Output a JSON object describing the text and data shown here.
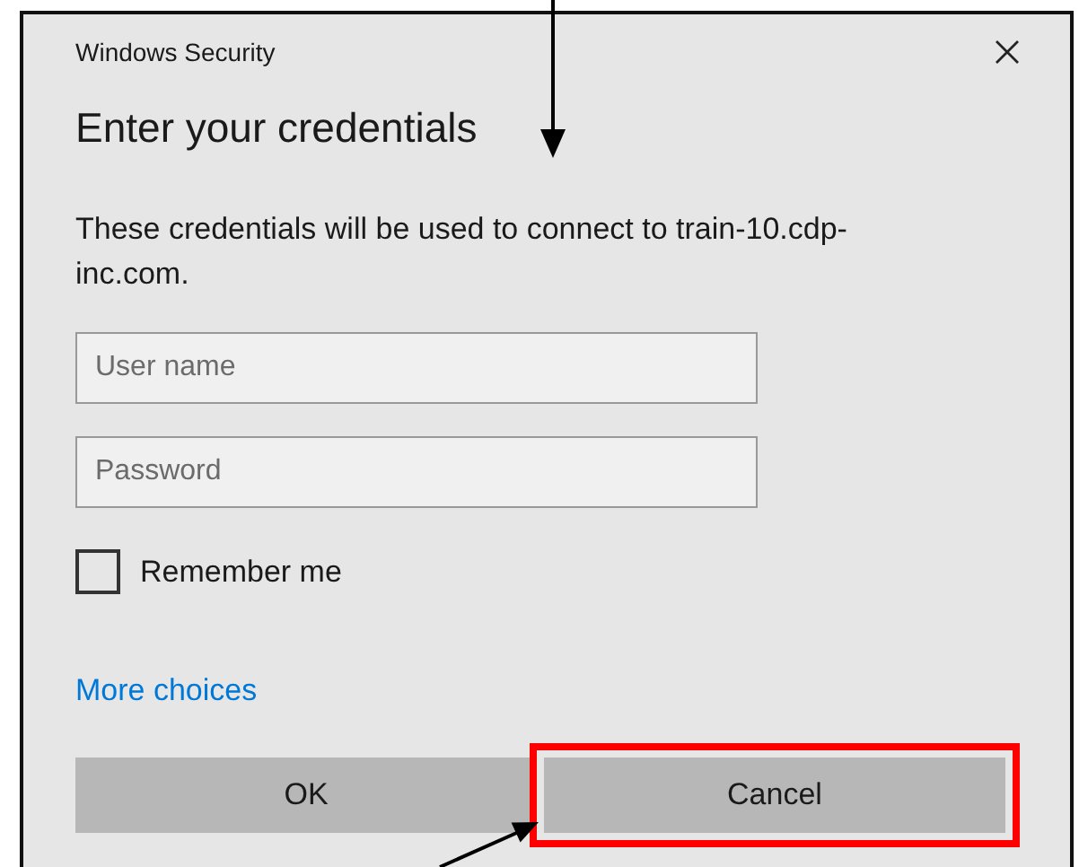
{
  "window": {
    "title": "Windows Security"
  },
  "heading": "Enter your credentials",
  "message": "These credentials will be used to connect to train-10.cdp-inc.com.",
  "fields": [
    {
      "placeholder": "User name"
    },
    {
      "placeholder": "Password"
    }
  ],
  "remember_me": {
    "label": "Remember me",
    "checked": false
  },
  "more_choices": "More choices",
  "buttons": [
    {
      "label": "OK",
      "highlighted": false
    },
    {
      "label": "Cancel",
      "highlighted": true
    }
  ]
}
